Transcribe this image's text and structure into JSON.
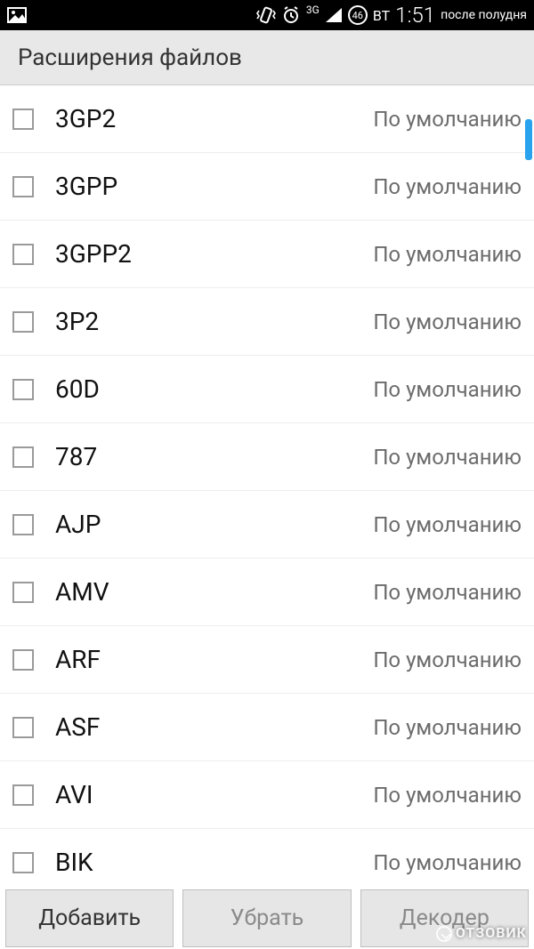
{
  "status": {
    "day": "ВТ",
    "time": "1:51",
    "ampm": "после полудня",
    "net_label": "3G",
    "badge": "46"
  },
  "header": {
    "title": "Расширения файлов"
  },
  "default_label": "По умолчанию",
  "items": [
    {
      "ext": "3GP2"
    },
    {
      "ext": "3GPP"
    },
    {
      "ext": "3GPP2"
    },
    {
      "ext": "3P2"
    },
    {
      "ext": "60D"
    },
    {
      "ext": "787"
    },
    {
      "ext": "AJP"
    },
    {
      "ext": "AMV"
    },
    {
      "ext": "ARF"
    },
    {
      "ext": "ASF"
    },
    {
      "ext": "AVI"
    },
    {
      "ext": "BIK"
    }
  ],
  "buttons": {
    "add": "Добавить",
    "remove": "Убрать",
    "decoder": "Декодер"
  },
  "watermark": "ОТЗОВИК"
}
